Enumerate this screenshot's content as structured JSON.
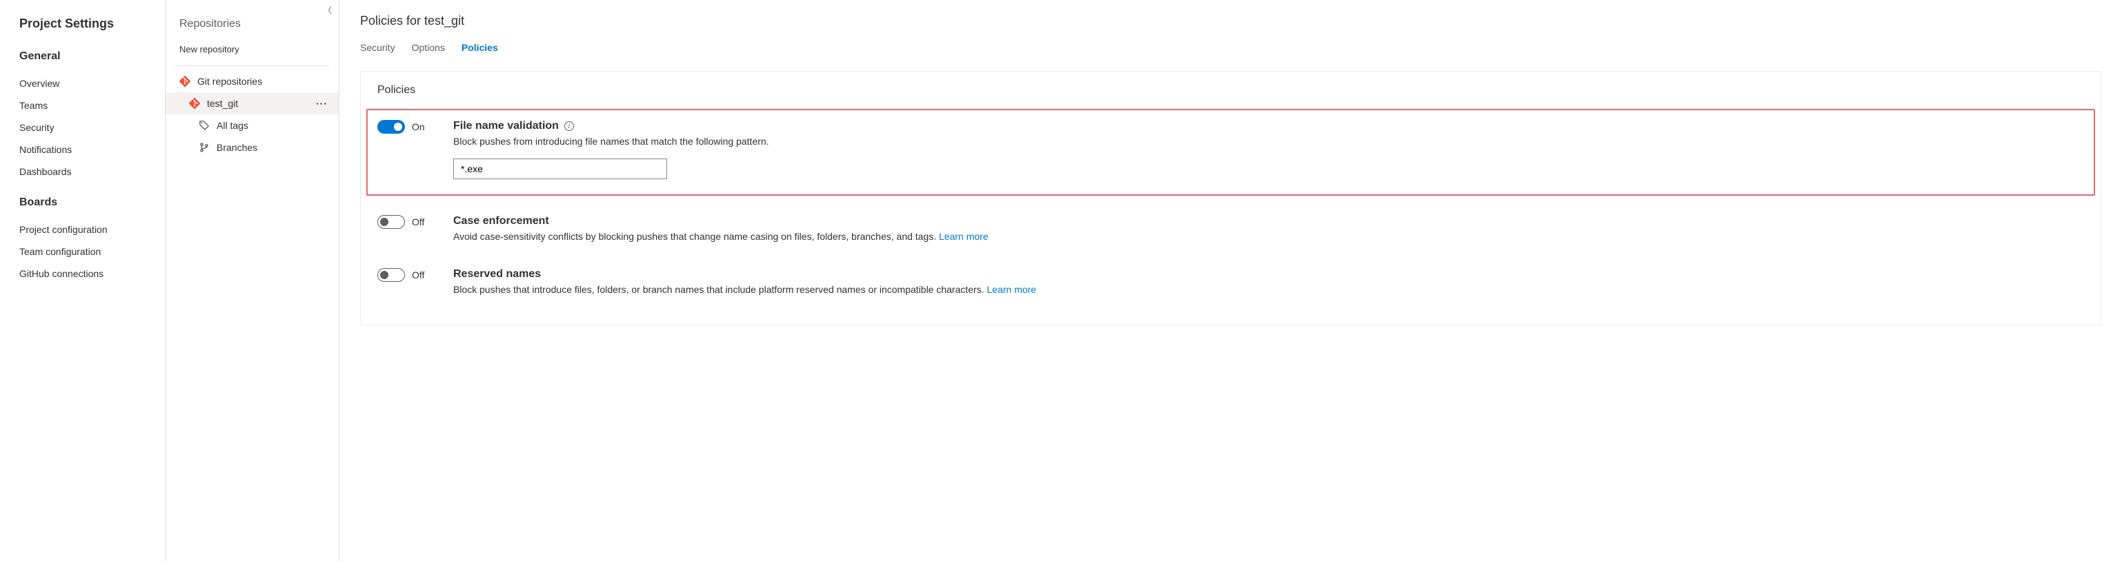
{
  "sidebar": {
    "title": "Project Settings",
    "sections": [
      {
        "heading": "General",
        "items": [
          "Overview",
          "Teams",
          "Security",
          "Notifications",
          "Dashboards"
        ]
      },
      {
        "heading": "Boards",
        "items": [
          "Project configuration",
          "Team configuration",
          "GitHub connections"
        ]
      }
    ]
  },
  "repo_panel": {
    "title": "Repositories",
    "new_label": "New repository",
    "root": "Git repositories",
    "selected_repo": "test_git",
    "children": [
      {
        "label": "All tags",
        "icon": "tag"
      },
      {
        "label": "Branches",
        "icon": "branch"
      }
    ]
  },
  "main": {
    "title": "Policies for test_git",
    "tabs": [
      "Security",
      "Options",
      "Policies"
    ],
    "active_tab": "Policies",
    "panel_heading": "Policies",
    "learn_more": "Learn more",
    "on_label": "On",
    "off_label": "Off",
    "policies": [
      {
        "key": "file_name_validation",
        "state": "on",
        "title": "File name validation",
        "desc": "Block pushes from introducing file names that match the following pattern.",
        "show_info": true,
        "input_value": "*.exe",
        "highlighted": true
      },
      {
        "key": "case_enforcement",
        "state": "off",
        "title": "Case enforcement",
        "desc": "Avoid case-sensitivity conflicts by blocking pushes that change name casing on files, folders, branches, and tags.",
        "learn_more": true
      },
      {
        "key": "reserved_names",
        "state": "off",
        "title": "Reserved names",
        "desc": "Block pushes that introduce files, folders, or branch names that include platform reserved names or incompatible characters.",
        "learn_more": true
      }
    ]
  }
}
